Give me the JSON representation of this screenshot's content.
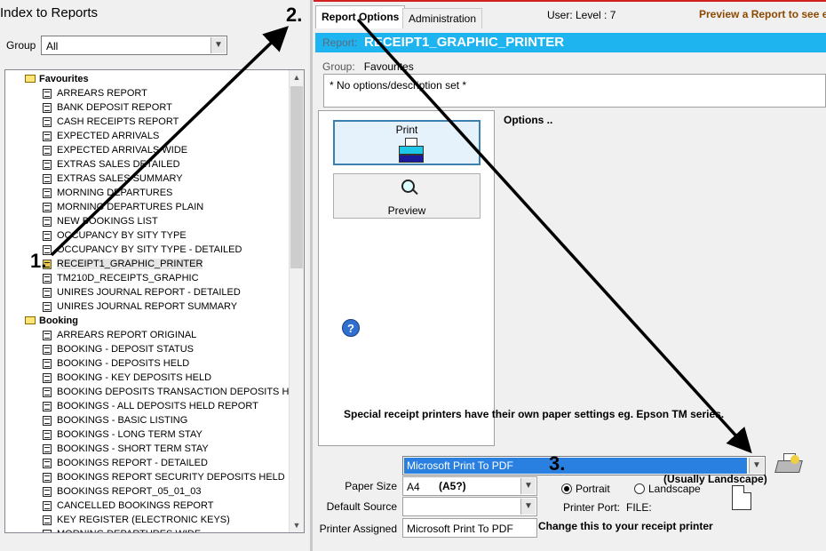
{
  "left_panel": {
    "title": "Index to Reports",
    "group_label": "Group",
    "group_value": "All",
    "tree": [
      {
        "kind": "folder",
        "label": "Favourites"
      },
      {
        "kind": "item",
        "label": "ARREARS REPORT"
      },
      {
        "kind": "item",
        "label": "BANK DEPOSIT REPORT"
      },
      {
        "kind": "item",
        "label": "CASH RECEIPTS REPORT"
      },
      {
        "kind": "item",
        "label": "EXPECTED ARRIVALS"
      },
      {
        "kind": "item",
        "label": "EXPECTED ARRIVALS WIDE"
      },
      {
        "kind": "item",
        "label": "EXTRAS SALES DETAILED"
      },
      {
        "kind": "item",
        "label": "EXTRAS SALES SUMMARY"
      },
      {
        "kind": "item",
        "label": "MORNING DEPARTURES"
      },
      {
        "kind": "item",
        "label": "MORNING DEPARTURES PLAIN"
      },
      {
        "kind": "item",
        "label": "NEW BOOKINGS LIST"
      },
      {
        "kind": "item",
        "label": "OCCUPANCY BY SITY TYPE"
      },
      {
        "kind": "item",
        "label": "OCCUPANCY BY SITY TYPE - DETAILED"
      },
      {
        "kind": "item",
        "label": "RECEIPT1_GRAPHIC_PRINTER",
        "selected": true
      },
      {
        "kind": "item",
        "label": "TM210D_RECEIPTS_GRAPHIC"
      },
      {
        "kind": "item",
        "label": "UNIRES JOURNAL REPORT - DETAILED"
      },
      {
        "kind": "item",
        "label": "UNIRES JOURNAL REPORT SUMMARY"
      },
      {
        "kind": "folder",
        "label": "Booking"
      },
      {
        "kind": "item",
        "label": "ARREARS REPORT ORIGINAL"
      },
      {
        "kind": "item",
        "label": "BOOKING - DEPOSIT STATUS"
      },
      {
        "kind": "item",
        "label": "BOOKING - DEPOSITS HELD"
      },
      {
        "kind": "item",
        "label": "BOOKING - KEY DEPOSITS HELD"
      },
      {
        "kind": "item",
        "label": "BOOKING DEPOSITS TRANSACTION DEPOSITS HELD"
      },
      {
        "kind": "item",
        "label": "BOOKINGS - ALL DEPOSITS HELD REPORT"
      },
      {
        "kind": "item",
        "label": "BOOKINGS - BASIC LISTING"
      },
      {
        "kind": "item",
        "label": "BOOKINGS - LONG TERM STAY"
      },
      {
        "kind": "item",
        "label": "BOOKINGS - SHORT TERM STAY"
      },
      {
        "kind": "item",
        "label": "BOOKINGS REPORT - DETAILED"
      },
      {
        "kind": "item",
        "label": "BOOKINGS REPORT SECURITY DEPOSITS HELD"
      },
      {
        "kind": "item",
        "label": "BOOKINGS REPORT_05_01_03"
      },
      {
        "kind": "item",
        "label": "CANCELLED BOOKINGS REPORT"
      },
      {
        "kind": "item",
        "label": "KEY REGISTER (ELECTRONIC KEYS)"
      },
      {
        "kind": "item",
        "label": "MORNING DEPARTURES WIDE"
      }
    ]
  },
  "tabs": {
    "report_options": "Report Options",
    "administration": "Administration"
  },
  "user_info": "User:  Level :  7",
  "preview_hint": "Preview a Report to see e",
  "report": {
    "label": "Report:",
    "name": "RECEIPT1_GRAPHIC_PRINTER",
    "group_key": "Group:",
    "group_value": "Favourites",
    "description": "* No options/description set *"
  },
  "buttons": {
    "print": "Print",
    "preview": "Preview"
  },
  "options_label": "Options ..",
  "special_note": "Special receipt printers have their own paper settings eg. Epson TM series.",
  "printer": {
    "selected": "Microsoft Print To PDF",
    "paper_size_label": "Paper Size",
    "paper_size": "A4",
    "default_source_label": "Default Source",
    "default_source": "",
    "orientation_portrait": "Portrait",
    "orientation_landscape": "Landscape",
    "orientation_selected": "Portrait",
    "printer_port_label": "Printer Port:",
    "printer_port": "FILE:",
    "printer_assigned_label": "Printer Assigned",
    "printer_assigned": "Microsoft Print To PDF"
  },
  "annotations": {
    "step1": "1.",
    "step2": "2.",
    "step3": "3.",
    "a5_note": "(A5?)",
    "landscape_note": "(Usually Landscape)",
    "change_note": "Change this to your receipt printer"
  },
  "colors": {
    "report_bar": "#1eb4f0",
    "selected_printer": "#2a80e0",
    "preview_hint": "#8b4a00",
    "tab_border": "#d02020"
  }
}
